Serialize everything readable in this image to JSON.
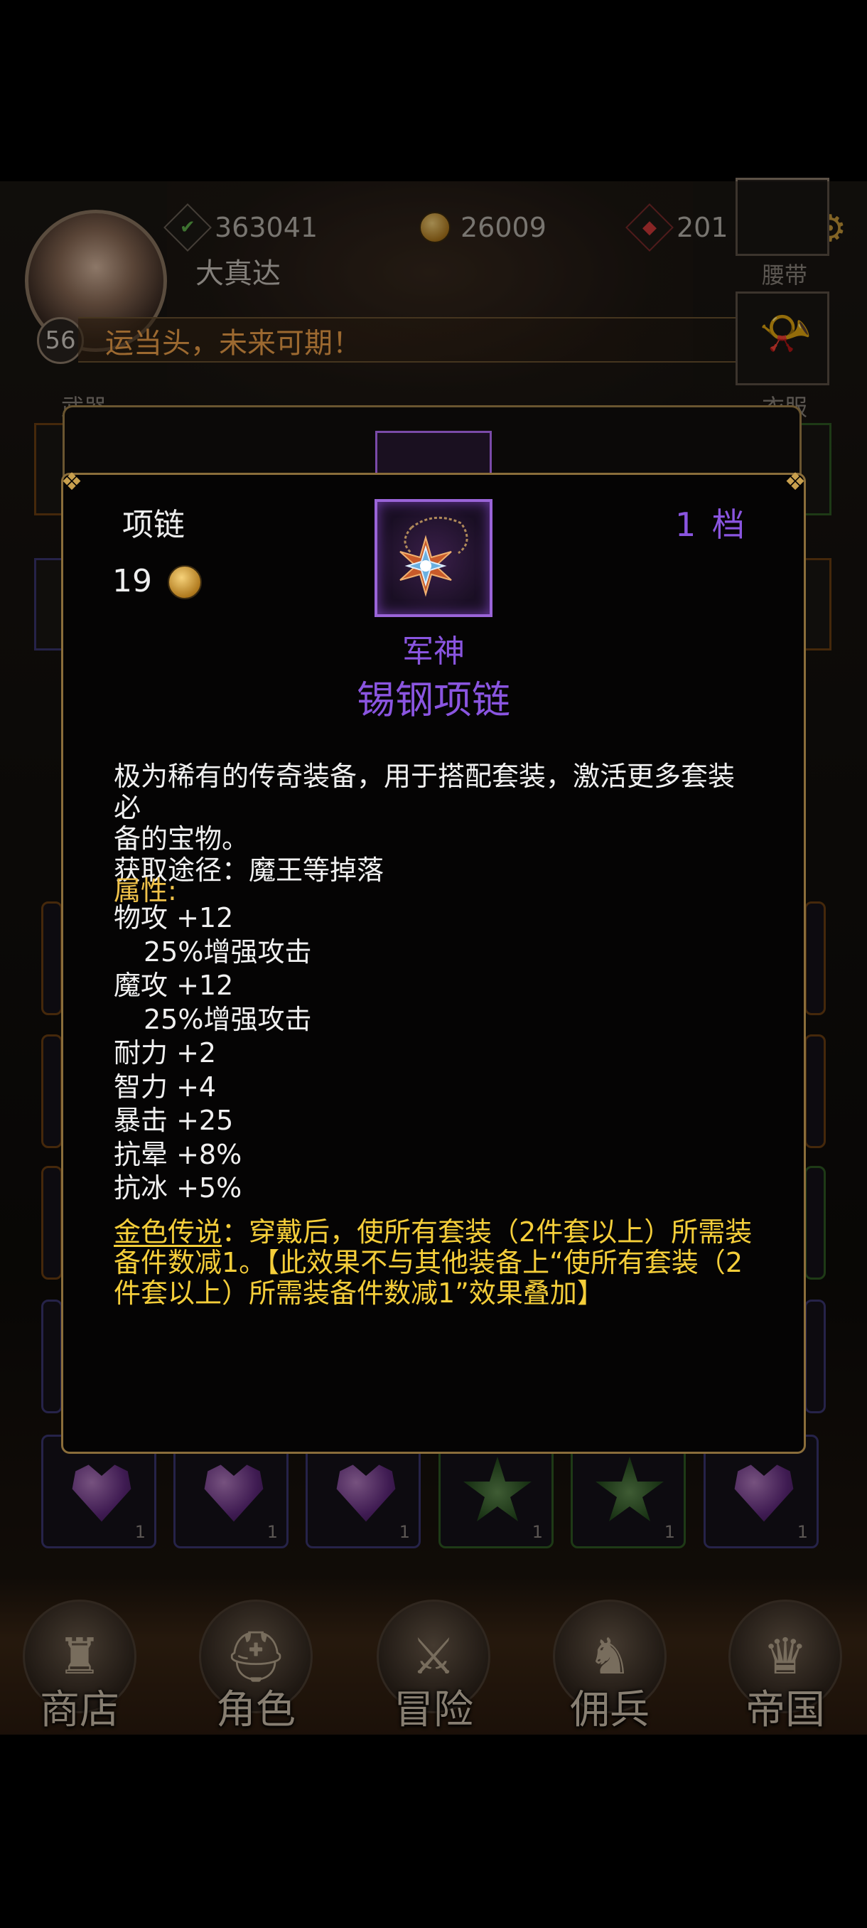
{
  "header": {
    "resources": [
      {
        "name": "green-crystal",
        "icon": "green-leaf-icon",
        "value": "363041"
      },
      {
        "name": "gold",
        "icon": "gold-coin-icon",
        "value": "26009"
      },
      {
        "name": "ruby",
        "icon": "red-gem-icon",
        "value": "201"
      }
    ],
    "player_name": "大真达",
    "level": "56",
    "motto": "运当头，未来可期！",
    "slot_labels": {
      "belt": "腰带",
      "weapon": "武器",
      "clothes": "衣服"
    }
  },
  "item_popup": {
    "type": "项链",
    "price": "19",
    "tier": "1  档",
    "prefix": "军神",
    "name": "锡钢项链",
    "description_lines": [
      "极为稀有的传奇装备，用于搭配套装，激活更多套装必",
      "备的宝物。",
      "获取途径：魔王等掉落"
    ],
    "attributes_title": "属性:",
    "attributes": [
      {
        "text": "物攻 +12",
        "sub": false
      },
      {
        "text": "25%增强攻击",
        "sub": true
      },
      {
        "text": "魔攻 +12",
        "sub": false
      },
      {
        "text": "25%增强攻击",
        "sub": true
      },
      {
        "text": "耐力 +2",
        "sub": false
      },
      {
        "text": "智力 +4",
        "sub": false
      },
      {
        "text": "暴击 +25",
        "sub": false
      },
      {
        "text": "抗晕 +8%",
        "sub": false
      },
      {
        "text": "抗冰 +5%",
        "sub": false
      }
    ],
    "legend_title": "金色传说",
    "legend_lines": [
      "：穿戴后，使所有套装（2件套以上）所需装",
      "备件数减1。【此效果不与其他装备上“使所有套装（2",
      "件套以上）所需装备件数减1”效果叠加】"
    ]
  },
  "inventory_bottom_row": [
    {
      "kind": "heart",
      "count": "1"
    },
    {
      "kind": "heart",
      "count": "1"
    },
    {
      "kind": "heart",
      "count": "1"
    },
    {
      "kind": "leaf",
      "count": "1"
    },
    {
      "kind": "leaf",
      "count": "1"
    },
    {
      "kind": "heart",
      "count": "1"
    }
  ],
  "bottom_nav": [
    {
      "label": "商店",
      "icon": "castle-icon"
    },
    {
      "label": "角色",
      "icon": "helmet-icon"
    },
    {
      "label": "冒险",
      "icon": "crossed-swords-icon"
    },
    {
      "label": "佣兵",
      "icon": "mercenary-card-icon"
    },
    {
      "label": "帝国",
      "icon": "crown-icon"
    }
  ]
}
